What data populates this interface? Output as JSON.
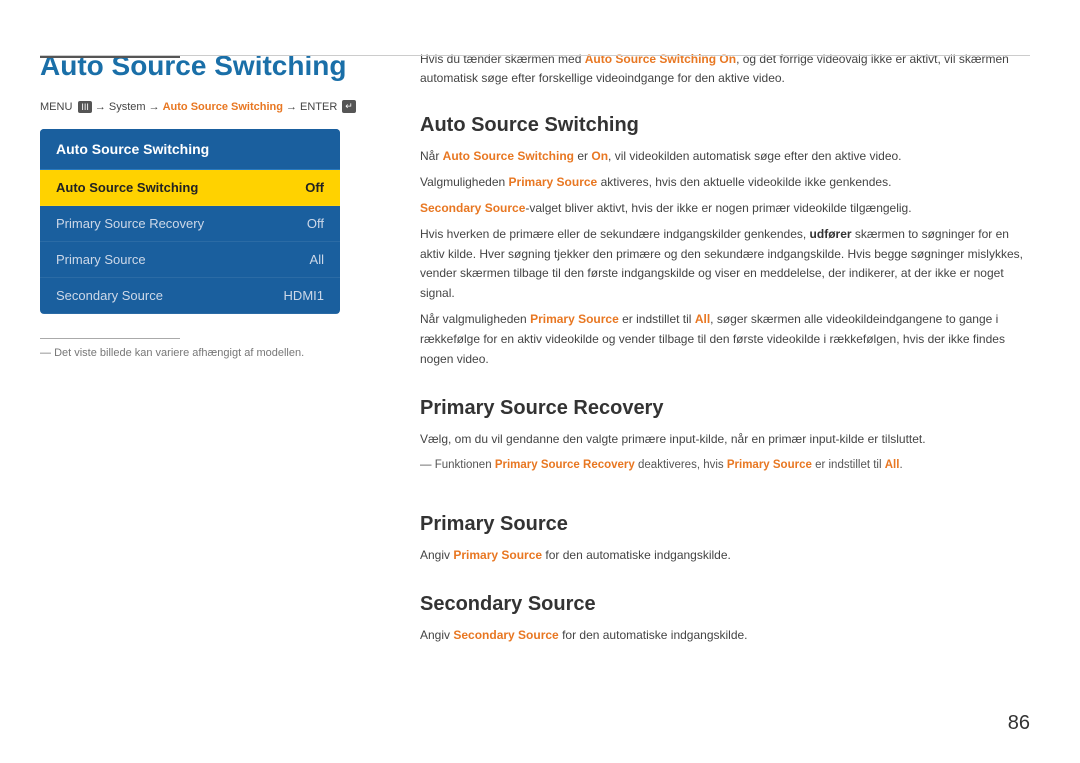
{
  "page": {
    "number": "86"
  },
  "top_rule": {},
  "left": {
    "title": "Auto Source Switching",
    "menu_path": {
      "menu": "MENU",
      "menu_icon": "III",
      "arrow1": "→",
      "system": "System",
      "arrow2": "→",
      "link": "Auto Source Switching",
      "arrow3": "→",
      "enter": "ENTER",
      "enter_icon": "↵"
    },
    "panel": {
      "title": "Auto Source Switching",
      "items": [
        {
          "label": "Auto Source Switching",
          "value": "Off",
          "active": true
        },
        {
          "label": "Primary Source Recovery",
          "value": "Off",
          "active": false
        },
        {
          "label": "Primary Source",
          "value": "All",
          "active": false
        },
        {
          "label": "Secondary Source",
          "value": "HDMI1",
          "active": false
        }
      ]
    },
    "footnote": "Det viste billede kan variere afhængigt af modellen."
  },
  "right": {
    "intro": "Hvis du tænder skærmen med Auto Source Switching On, og det forrige videovalg ikke er aktivt, vil skærmen automatisk søge efter forskellige videoindgange for den aktive video.",
    "intro_bold": "Auto Source Switching On",
    "sections": [
      {
        "id": "auto-source-switching",
        "title": "Auto Source Switching",
        "paragraphs": [
          "Når Auto Source Switching er On, vil videokilden automatisk søge efter den aktive video.",
          "Valgmuligheden Primary Source aktiveres, hvis den aktuelle videokilde ikke genkendes.",
          "Secondary Source-valget bliver aktivt, hvis der ikke er nogen primær videokilde tilgængelig.",
          "Hvis hverken de primære eller de sekundære indgangskilder genkendes, udfører skærmen to søgninger for en aktiv kilde. Hver søgning tjekker den primære og den sekundære indgangskilde. Hvis begge søgninger mislykkes, vender skærmen tilbage til den første indgangskilde og viser en meddelelse, der indikerer, at der ikke er noget signal.",
          "Når valgmuligheden Primary Source er indstillet til All, søger skærmen alle videokildeindgangene to gange i rækkefølge for en aktiv videokilde og vender tilbage til den første videokilde i rækkefølgen, hvis der ikke findes nogen video."
        ]
      },
      {
        "id": "primary-source-recovery",
        "title": "Primary Source Recovery",
        "paragraphs": [
          "Vælg, om du vil gendanne den valgte primære input-kilde, når en primær input-kilde er tilsluttet."
        ],
        "note": "Funktionen Primary Source Recovery deaktiveres, hvis Primary Source er indstillet til All."
      },
      {
        "id": "primary-source",
        "title": "Primary Source",
        "paragraphs": [
          "Angiv Primary Source for den automatiske indgangskilde."
        ]
      },
      {
        "id": "secondary-source",
        "title": "Secondary Source",
        "paragraphs": [
          "Angiv Secondary Source for den automatiske indgangskilde."
        ]
      }
    ]
  }
}
